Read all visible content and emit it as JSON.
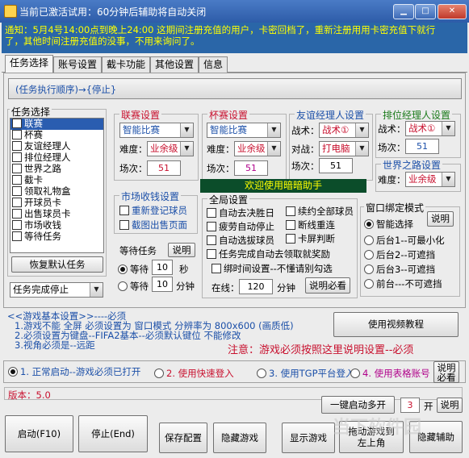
{
  "window": {
    "title": "当前已激活试用：60分钟后辅助将自动关闭",
    "min": "▁",
    "max": "□",
    "close": "✕"
  },
  "notice": {
    "line1": "通知：5月4号14:00点到晚上24:00 这期间注册充值的用户，卡密回档了，重新注册用用卡密充值下就行",
    "line2": "了，其他时间注册充值的没事，不用来询问了。"
  },
  "tabs": [
    "任务选择",
    "账号设置",
    "截卡功能",
    "其他设置",
    "信息"
  ],
  "order": "(任务执行顺序)→{停止}",
  "task_group": {
    "title": "任务选择",
    "items": [
      "联赛",
      "杯赛",
      "友谊经理人",
      "排位经理人",
      "世界之路",
      "截卡",
      "领取礼物盒",
      "开球员卡",
      "出售球员卡",
      "市场收钱",
      "等待任务"
    ],
    "restore": "恢复默认任务"
  },
  "finish": {
    "value": "任务完成停止"
  },
  "league": {
    "title": "联赛设置",
    "mode": "智能比赛",
    "diff_label": "难度：",
    "diff": "业余级",
    "count_label": "场次：",
    "count": "51"
  },
  "cup": {
    "title": "杯赛设置",
    "mode": "智能比赛",
    "diff_label": "难度：",
    "diff": "业余级",
    "count_label": "场次：",
    "count": "51"
  },
  "friendly": {
    "title": "友谊经理人设置",
    "tactic_label": "战术：",
    "tactic": "战术①",
    "opp_label": "对战：",
    "opp": "打电脑",
    "count_label": "场次：",
    "count": "51"
  },
  "rank": {
    "title": "排位经理人设置",
    "tactic_label": "战术：",
    "tactic": "战术①",
    "count_label": "场次：",
    "count": "51"
  },
  "world": {
    "title": "世界之路设置",
    "diff_label": "难度：",
    "diff": "业余级"
  },
  "banner": "欢迎使用暗暗助手",
  "market": {
    "title": "市场收钱设置",
    "opt1": "重新登记球员",
    "opt2": "截图出售页面"
  },
  "global": {
    "title": "全局设置",
    "c1": "自动去决胜日",
    "c2": "续约全部球员",
    "c3": "疲劳自动停止",
    "c4": "断线重连",
    "c5": "自动选拔球员",
    "c6": "卡屏判断",
    "c7": "任务完成自动去领取就奖励",
    "c8": "绑时间设置--不懂请别勾选",
    "online_label": "在线：",
    "online": "120",
    "minutes": "分钟",
    "help": "说明必看"
  },
  "wait": {
    "title": "等待任务",
    "help": "说明",
    "r1_label": "等待",
    "r1_val": "10",
    "r1_unit": "秒",
    "r2_label": "等待",
    "r2_val": "10",
    "r2_unit": "分钟"
  },
  "window_mode": {
    "title": "窗口绑定模式",
    "help": "说明",
    "opts": [
      "智能选择",
      "后台1--可最小化",
      "后台2--可遮挡",
      "后台3--可遮挡",
      "前台---不可遮挡"
    ]
  },
  "info": {
    "line0": "<<游戏基本设置>>----必须",
    "line1": "1.游戏不能 全屏 必须设置为 窗口模式 分辨率为 800x600 (画质低)",
    "line2": "2.必须设置为键盘--FIFA2基本--必须默认键位 不能修改",
    "line3": "3.视角必须是--远距",
    "video_btn": "使用视频教程",
    "warning": "注意：游戏必须按照这里说明设置--必须"
  },
  "login": {
    "o1": "1. 正常启动--游戏必须已打开",
    "o2": "2. 使用快速登入",
    "o3": "3. 使用TGP平台登入",
    "o4": "4. 使用表格账号",
    "help": "说明必看"
  },
  "version": "版本：5.0",
  "multi": {
    "btn": "一键启动多开",
    "count": "3",
    "unit": "开",
    "help": "说明"
  },
  "actions": [
    "启动(F10)",
    "停止(End)",
    "保存配置",
    "隐藏游戏",
    "显示游戏",
    "拖动游戏到左上角",
    "隐藏辅助"
  ],
  "watermark": "当下软件园"
}
